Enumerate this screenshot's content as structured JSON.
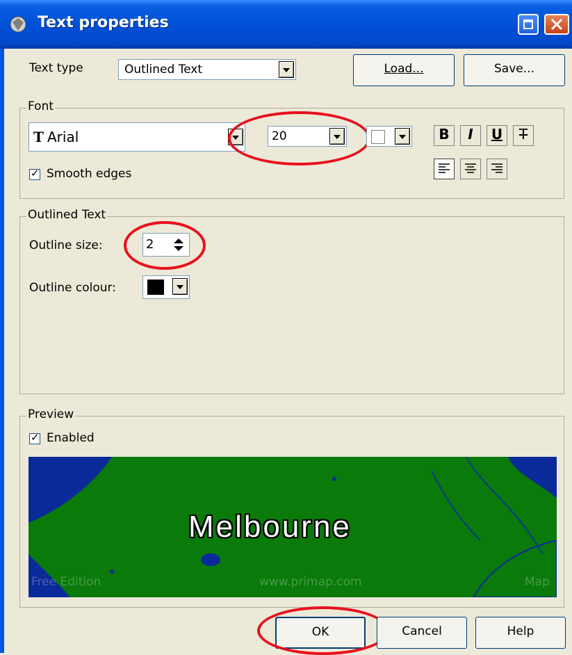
{
  "window": {
    "title": "Text properties"
  },
  "text_type": {
    "label": "Text type",
    "value": "Outlined Text"
  },
  "buttons": {
    "load": "Load...",
    "save": "Save...",
    "ok": "OK",
    "cancel": "Cancel",
    "help": "Help"
  },
  "font_group": {
    "title": "Font",
    "font_name": "Arial",
    "font_icon_glyph": "T",
    "size": "20",
    "smooth_edges_label": "Smooth edges",
    "smooth_edges_checked": true,
    "bold": "B",
    "italic": "I",
    "underline": "U",
    "strike": "T"
  },
  "outlined_group": {
    "title": "Outlined Text",
    "outline_size_label": "Outline size:",
    "outline_size_value": "2",
    "outline_colour_label": "Outline colour:",
    "outline_colour": "#000000"
  },
  "preview_group": {
    "title": "Preview",
    "enabled_label": "Enabled",
    "enabled_checked": true,
    "preview_text": "Melbourne",
    "watermark_left": "Free Edition",
    "watermark_center": "www.primap.com",
    "watermark_right": "Map"
  },
  "colors": {
    "annotation": "#e8101c",
    "land": "#0a7a0a",
    "water": "#0a2a9a",
    "titlebar": "#0050d8"
  }
}
